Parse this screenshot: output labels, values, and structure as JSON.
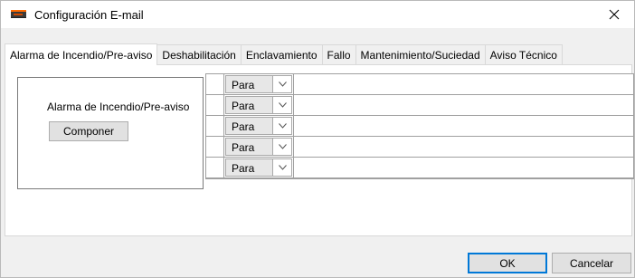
{
  "window": {
    "title": "Configuración E-mail",
    "icon": "fire-panel-icon"
  },
  "tabs": [
    {
      "label": "Alarma de Incendio/Pre-aviso",
      "active": true
    },
    {
      "label": "Deshabilitación",
      "active": false
    },
    {
      "label": "Enclavamiento",
      "active": false
    },
    {
      "label": "Fallo",
      "active": false
    },
    {
      "label": "Mantenimiento/Suciedad",
      "active": false
    },
    {
      "label": "Aviso Técnico",
      "active": false
    }
  ],
  "group": {
    "label": "Alarma de Incendio/Pre-aviso",
    "compose_button": "Componer"
  },
  "recipients": [
    {
      "type": "Para",
      "address": ""
    },
    {
      "type": "Para",
      "address": ""
    },
    {
      "type": "Para",
      "address": ""
    },
    {
      "type": "Para",
      "address": ""
    },
    {
      "type": "Para",
      "address": ""
    }
  ],
  "footer": {
    "ok_label": "OK",
    "cancel_label": "Cancelar"
  }
}
